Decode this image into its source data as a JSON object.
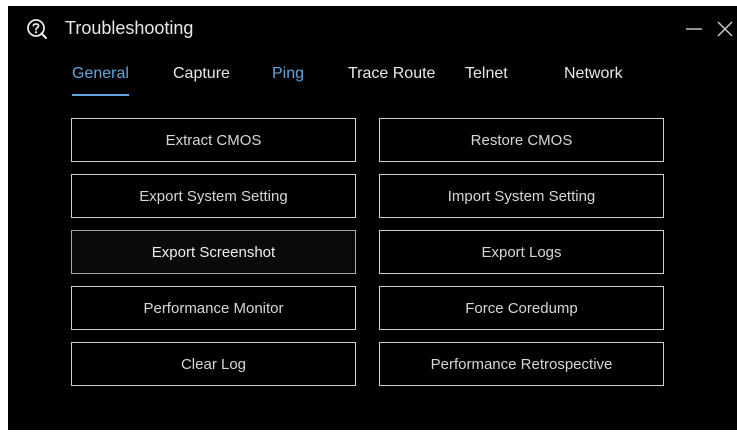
{
  "window": {
    "title": "Troubleshooting",
    "icon": "help-wrench-icon",
    "controls": [
      "minimize-icon",
      "close-icon"
    ]
  },
  "tabs": [
    {
      "label": "General",
      "active": true
    },
    {
      "label": "Capture",
      "active": false
    },
    {
      "label": "Ping",
      "active": false
    },
    {
      "label": "Trace Route",
      "active": false
    },
    {
      "label": "Telnet",
      "active": false
    },
    {
      "label": "Network",
      "active": false
    }
  ],
  "actions": {
    "extract_cmos": "Extract CMOS",
    "restore_cmos": "Restore CMOS",
    "export_system_setting": "Export System Setting",
    "import_system_setting": "Import System Setting",
    "export_screenshot": "Export Screenshot",
    "export_logs": "Export Logs",
    "performance_monitor": "Performance Monitor",
    "force_coredump": "Force Coredump",
    "clear_log": "Clear Log",
    "performance_retrospective": "Performance Retrospective"
  },
  "colors": {
    "background": "#000000",
    "accent": "#63a6de",
    "text": "#e8e8e8",
    "button_border": "#cfcfcf"
  }
}
